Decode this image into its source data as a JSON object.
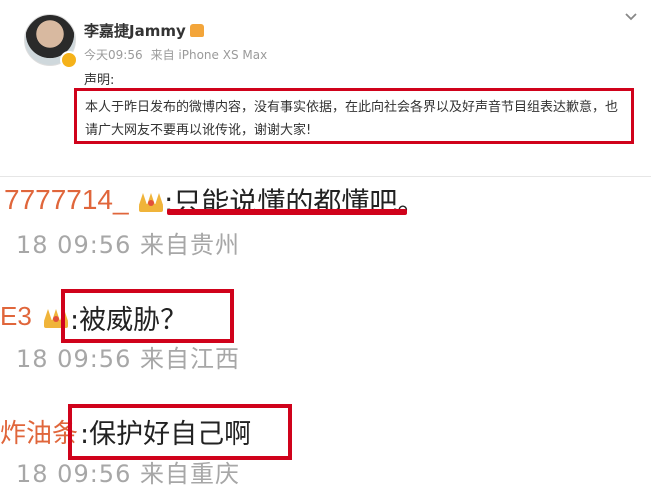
{
  "post": {
    "username": "李嘉捷Jammy",
    "time": "今天09:56",
    "source": "来自 iPhone XS Max",
    "statement_label": "声明:",
    "statement_text": "本人于昨日发布的微博内容，没有事实依据，在此向社会各界以及好声音节目组表达歉意，也请广大网友不要再以讹传讹，谢谢大家!"
  },
  "comments": [
    {
      "name": "7777714_",
      "text": ":只能说懂的都懂吧。",
      "time": "18 09:56 来自贵州"
    },
    {
      "name": "E3",
      "text": ":被威胁？",
      "time": "18 09:56 来自江西"
    },
    {
      "name": "炸油条",
      "text": ":保护好自己啊",
      "time": "18 09:56 来自重庆"
    }
  ],
  "colors": {
    "highlight": "#d0021b",
    "vip_name": "#e0663b",
    "crown": "#f0b43a",
    "meta": "#a7a7a7"
  }
}
